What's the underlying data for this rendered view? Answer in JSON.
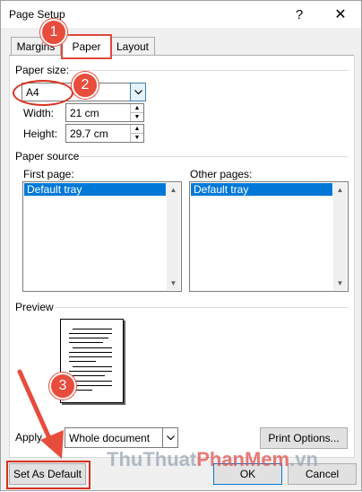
{
  "window": {
    "title": "Page Setup",
    "help_glyph": "?",
    "close_glyph": "✕"
  },
  "tabs": [
    {
      "label": "Margins"
    },
    {
      "label": "Paper"
    },
    {
      "label": "Layout"
    }
  ],
  "paper_size": {
    "group_label": "Paper size:",
    "selected": "A4",
    "width_label": "Width:",
    "width_value": "21 cm",
    "height_label": "Height:",
    "height_value": "29.7 cm"
  },
  "paper_source": {
    "group_label": "Paper source",
    "first_page_label": "First page:",
    "first_page_items": [
      "Default tray"
    ],
    "other_pages_label": "Other pages:",
    "other_pages_items": [
      "Default tray"
    ]
  },
  "preview": {
    "label": "Preview"
  },
  "apply_to": {
    "label": "Apply",
    "value": "Whole document"
  },
  "buttons": {
    "print_options": "Print Options...",
    "set_as_default": "Set As Default",
    "ok": "OK",
    "cancel": "Cancel"
  },
  "annotations": {
    "step1": "1",
    "step2": "2",
    "step3": "3",
    "accent_color": "#e74c3c"
  },
  "watermark": {
    "part1": "ThuThuat",
    "part2": "PhanMem",
    "part3": ".vn"
  },
  "icons": {
    "help": "help-icon",
    "close": "close-icon",
    "dropdown": "chevron-down-icon",
    "spin_up": "spin-up-icon",
    "spin_down": "spin-down-icon"
  }
}
